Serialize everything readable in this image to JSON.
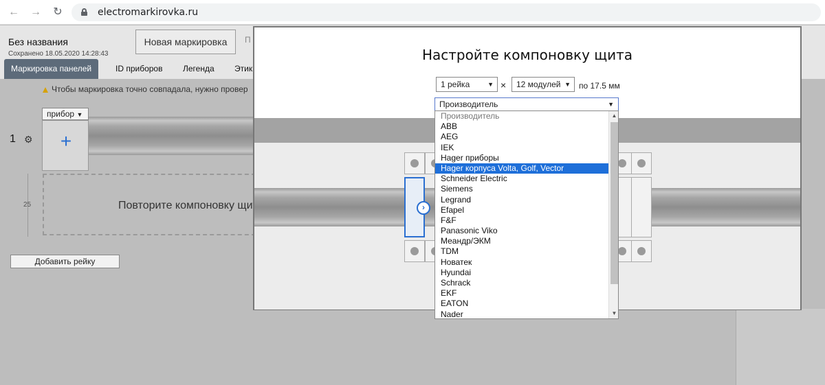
{
  "browser": {
    "url": "electromarkirovka.ru"
  },
  "app": {
    "doc_title": "Без названия",
    "saved": "Сохранено 18.05.2020 14:28:43",
    "new_button": "Новая маркировка",
    "hidden_button_initial": "П",
    "tabs": [
      "Маркировка панелей",
      "ID приборов",
      "Легенда",
      "Этик"
    ],
    "warning": "Чтобы маркировка точно совпадала, нужно провер",
    "row_number": "1",
    "device_select": "прибор",
    "repeat_text": "Повторите компоновку щит",
    "measure": "25",
    "add_rail": "Добавить рейку"
  },
  "modal": {
    "title": "Настройте компоновку щита",
    "rails_select": "1 рейка",
    "times": "×",
    "modules_select": "12 модулей",
    "module_width": "по 17.5 мм",
    "manufacturer_select": "Производитель",
    "manufacturers": [
      "Производитель",
      "ABB",
      "AEG",
      "IEK",
      "Hager приборы",
      "Hager корпуса Volta, Golf, Vector",
      "Schneider Electric",
      "Siemens",
      "Legrand",
      "Efapel",
      "F&F",
      "Panasonic Viko",
      "Меандр/ЭКМ",
      "TDM",
      "Новатек",
      "Hyundai",
      "Schrack",
      "EKF",
      "EATON",
      "Nader"
    ],
    "selected_index": 5
  },
  "colors": {
    "accent": "#1e6fd9",
    "tab_active": "#5d6b7a"
  }
}
